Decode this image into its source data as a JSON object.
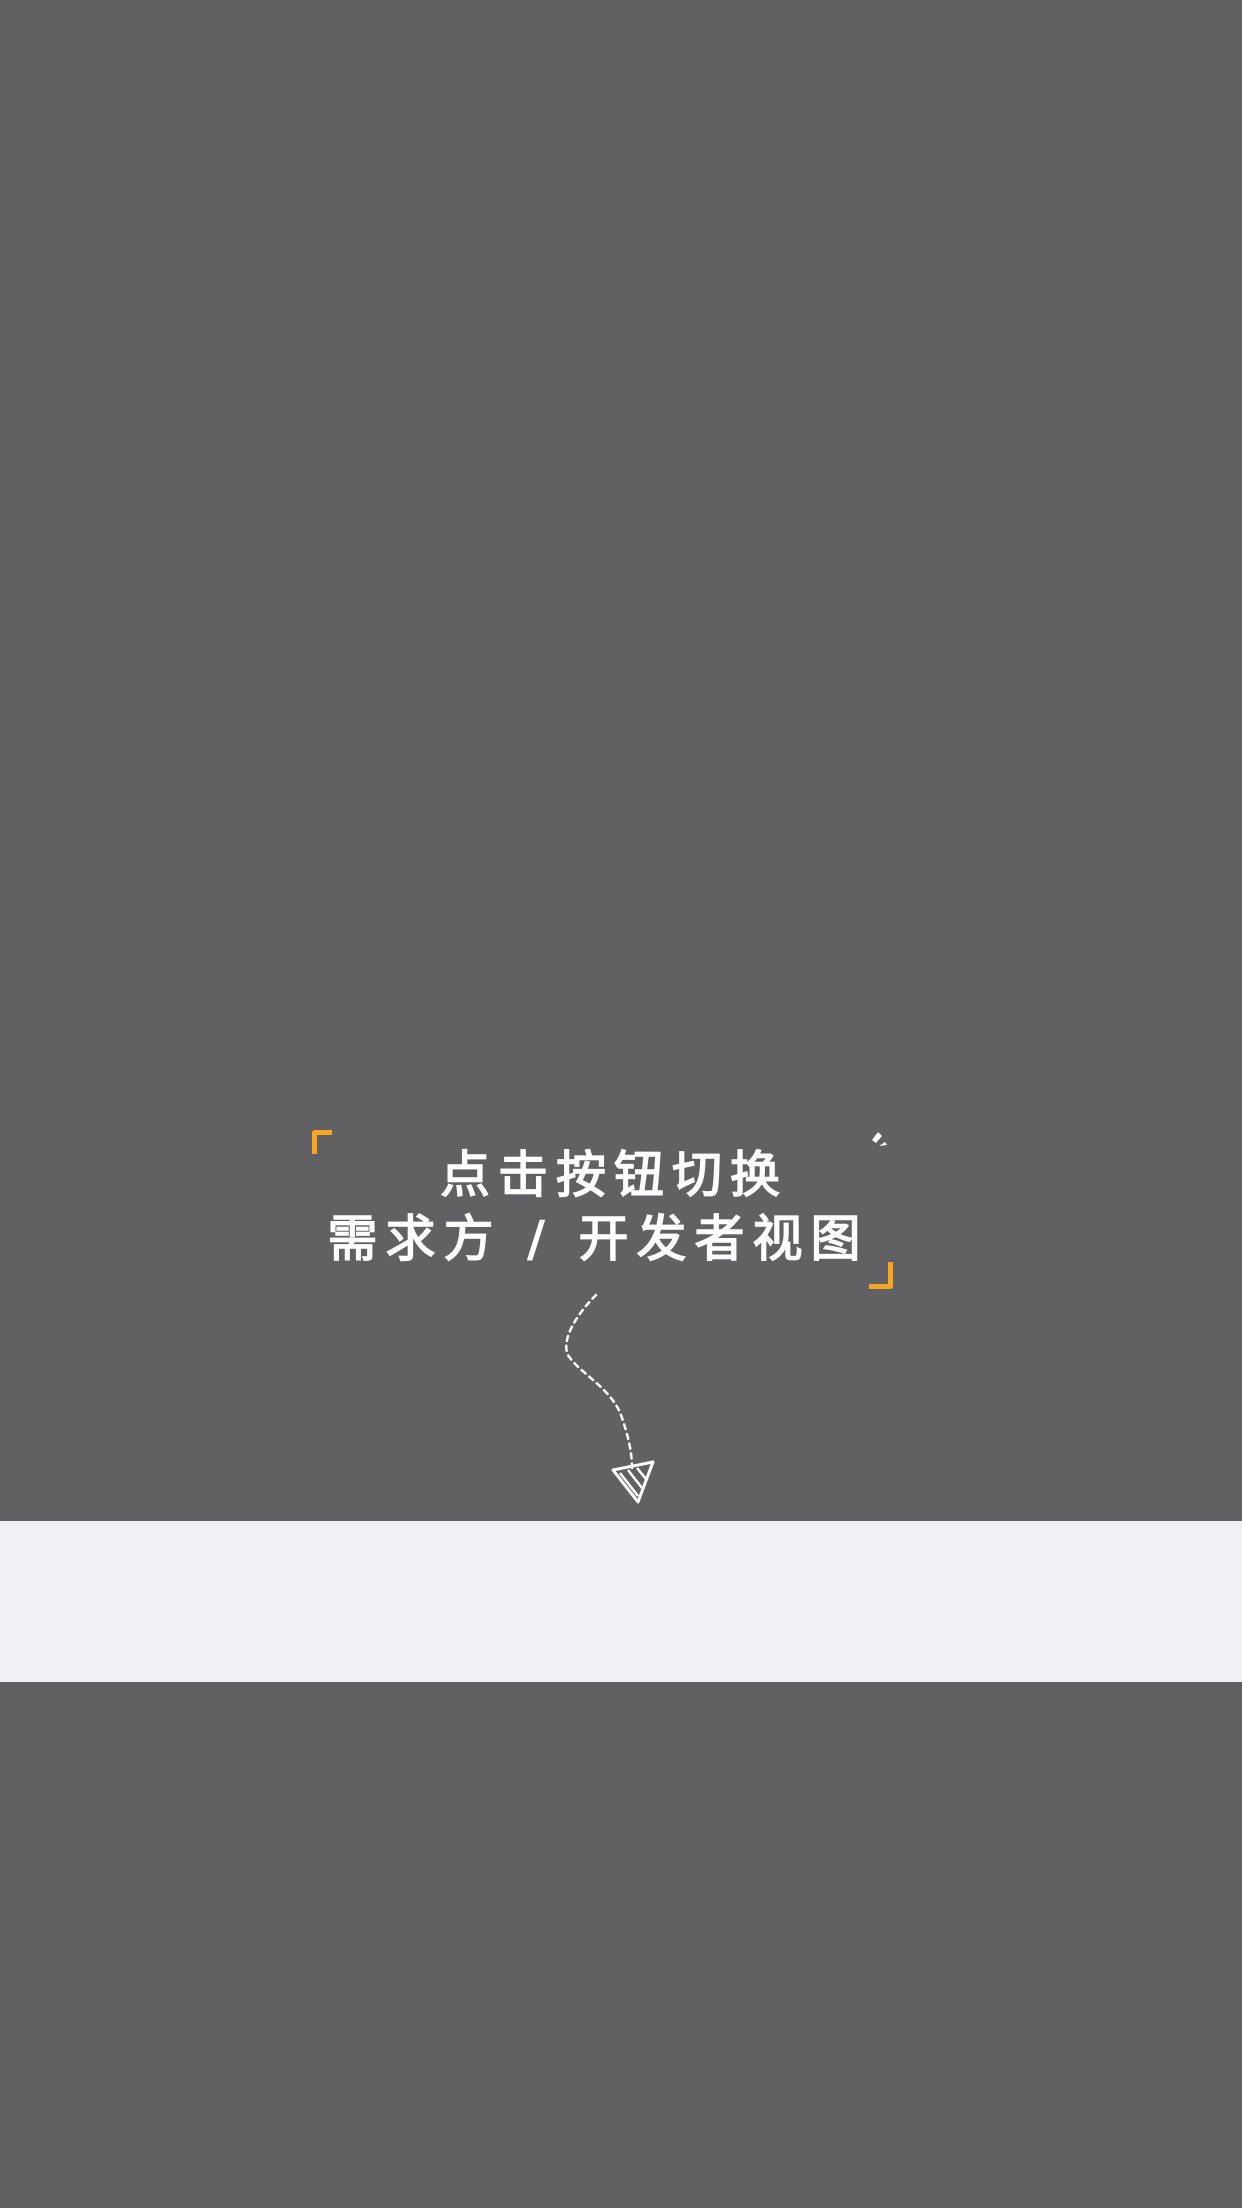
{
  "guide": {
    "line1": "点击按钮切换",
    "line2": "需求方 / 开发者视图"
  },
  "colors": {
    "overlay": "#616163",
    "accent": "#f5a623",
    "text": "#ffffff",
    "toolbar": "#f0f1f5"
  },
  "icons": {
    "arrow": "dashed-curved-arrow-icon",
    "spark": "spark-icon"
  }
}
